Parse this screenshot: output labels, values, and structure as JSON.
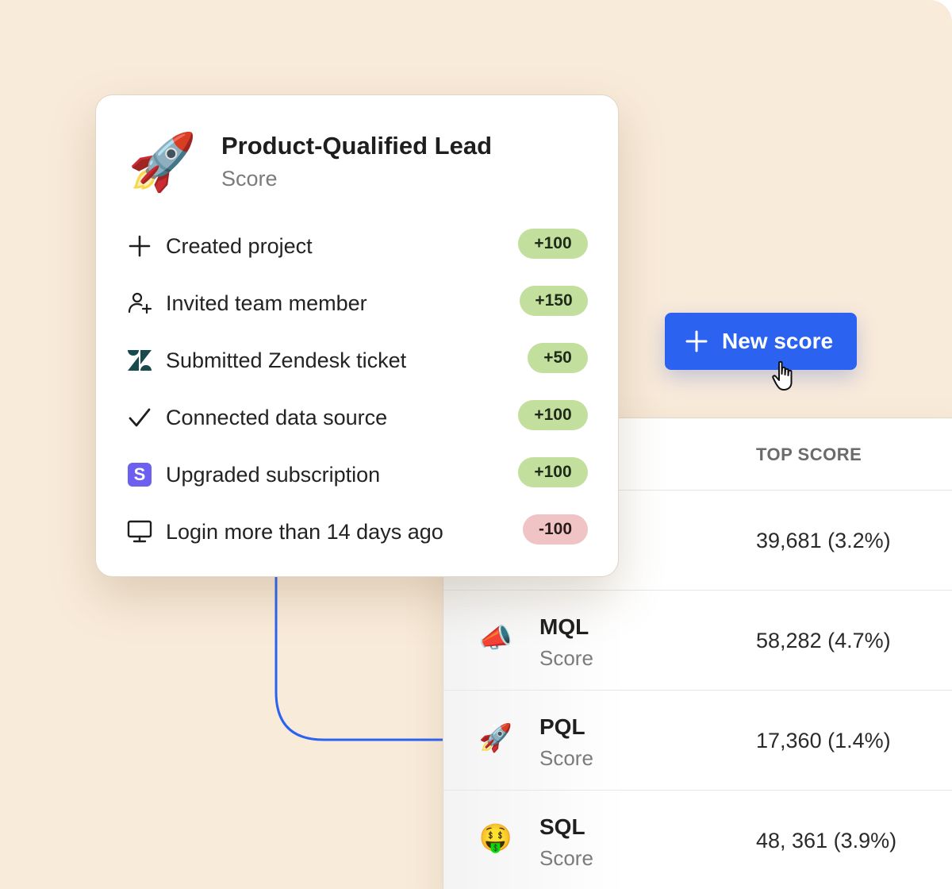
{
  "card": {
    "title": "Product-Qualified Lead",
    "subtitle": "Score",
    "emoji": "🚀",
    "rules": [
      {
        "label": "Created project",
        "points": "+100",
        "icon": "plus-icon",
        "kind": "pos"
      },
      {
        "label": "Invited team member",
        "points": "+150",
        "icon": "user-plus-icon",
        "kind": "pos"
      },
      {
        "label": "Submitted Zendesk ticket",
        "points": "+50",
        "icon": "zendesk-icon",
        "kind": "pos"
      },
      {
        "label": "Connected data source",
        "points": "+100",
        "icon": "checkmark-icon",
        "kind": "pos"
      },
      {
        "label": "Upgraded subscription",
        "points": "+100",
        "icon": "stripe-icon",
        "kind": "pos"
      },
      {
        "label": "Login more than 14 days ago",
        "points": "-100",
        "icon": "monitor-icon",
        "kind": "neg"
      }
    ],
    "stripe_letter": "S"
  },
  "button": {
    "label": "New score",
    "icon": "plus-icon",
    "color": "#2b63f0"
  },
  "table": {
    "header": {
      "top_score": "TOP SCORE"
    },
    "rows": [
      {
        "emoji": "",
        "name": "",
        "sub": "",
        "value": "39,681 (3.2%)"
      },
      {
        "emoji": "📣",
        "name": "MQL",
        "sub": "Score",
        "value": "58,282 (4.7%)"
      },
      {
        "emoji": "🚀",
        "name": "PQL",
        "sub": "Score",
        "value": "17,360 (1.4%)"
      },
      {
        "emoji": "🤑",
        "name": "SQL",
        "sub": "Score",
        "value": "48, 361 (3.9%)"
      }
    ]
  },
  "colors": {
    "background": "#f9ebda",
    "accent": "#2b63f0",
    "positive_badge": "#c3df9d",
    "negative_badge": "#f0c4c4"
  }
}
